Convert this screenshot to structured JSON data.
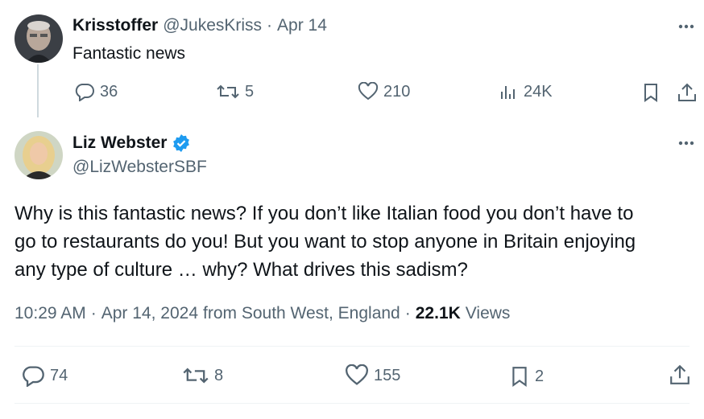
{
  "reply": {
    "author_name": "Krisstoffer",
    "author_handle": "@JukesKriss",
    "separator": "·",
    "date": "Apr 14",
    "text": "Fantastic news",
    "more_icon": "more-dots-icon",
    "actions": {
      "replies": "36",
      "reposts": "5",
      "likes": "210",
      "views": "24K"
    }
  },
  "main": {
    "author_name": "Liz Webster",
    "author_handle": "@LizWebsterSBF",
    "verified_icon": "verified-badge-icon",
    "text_line1": "Why is this fantastic news? If you don’t like Italian food you don’t have to",
    "text_line2": "go to restaurants do you! But you want to stop anyone in Britain enjoying",
    "text_line3": "any type of culture … why? What drives this sadism?",
    "meta": {
      "time": "10:29 AM",
      "sep1": "·",
      "date": "Apr 14, 2024",
      "location": "from South West, England",
      "sep2": "·",
      "views_count": "22.1K",
      "views_label": "Views"
    },
    "actions": {
      "replies": "74",
      "reposts": "8",
      "likes": "155",
      "bookmarks": "2"
    }
  },
  "colors": {
    "accent": "#1d9bf0",
    "muted": "#536471",
    "text": "#0f1419",
    "divider": "#eff3f4"
  }
}
